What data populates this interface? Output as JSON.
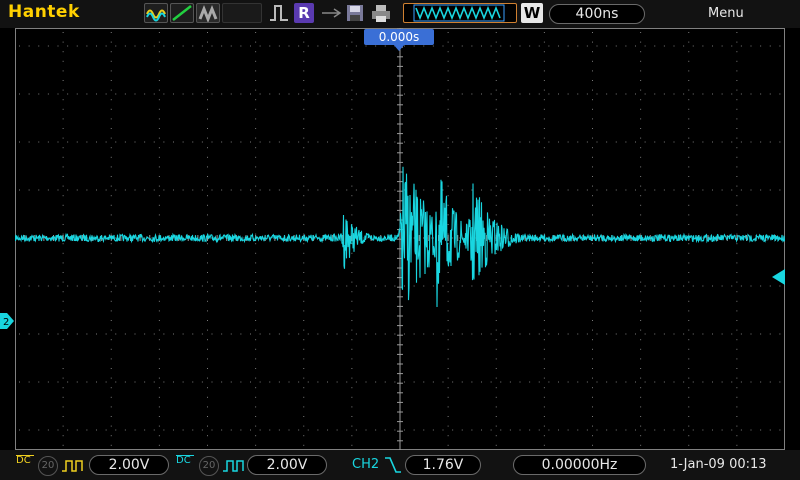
{
  "header": {
    "brand": "Hantek",
    "trigger_letter": "R",
    "time_mode_letter": "W",
    "timebase": "400ns",
    "menu_label": "Menu"
  },
  "screen": {
    "trigger_position": "0.000s",
    "waveform_color": "#19d6e0",
    "grid_color": "#808080"
  },
  "footer": {
    "ch1": {
      "coupling": "DC",
      "bw": "20",
      "scale": "2.00V"
    },
    "ch2": {
      "coupling": "DC",
      "bw": "20",
      "scale": "2.00V"
    },
    "trigger": {
      "source": "CH2",
      "level": "1.76V"
    },
    "frequency": "0.00000Hz",
    "datetime": "1-Jan-09 00:13"
  },
  "colors": {
    "brand": "#ffd000",
    "ch1": "#f0d020",
    "ch2": "#19d6e0",
    "trigger_box": "#3a6fd6"
  }
}
